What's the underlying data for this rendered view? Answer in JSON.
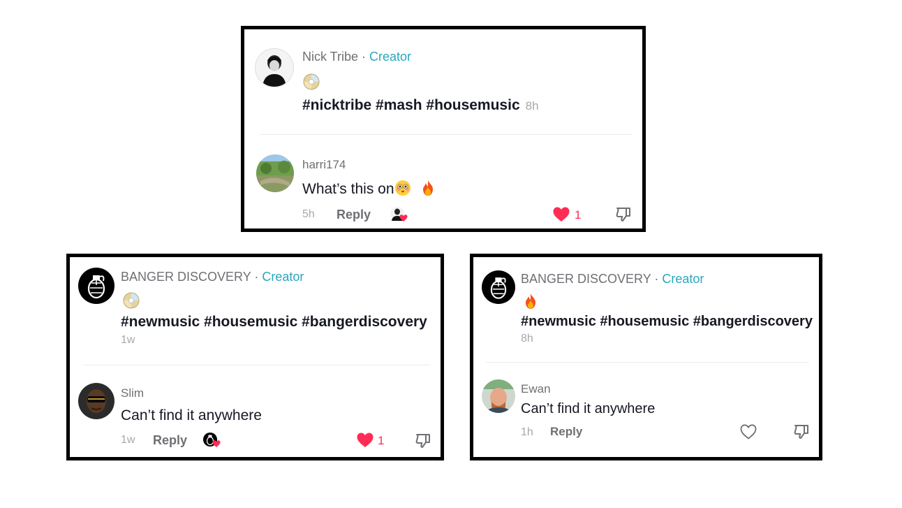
{
  "cards": [
    {
      "author": "Nick Tribe",
      "creator_separator": " · ",
      "creator_label": "Creator",
      "emoji": "cd-emoji",
      "hashtags": "#nicktribe #mash #housemusic",
      "time": "8h",
      "reply": {
        "user": "harri174",
        "text": "What’s this on",
        "emojis": [
          "flushed-face-emoji",
          "fire-emoji"
        ],
        "time": "5h",
        "reply_label": "Reply",
        "liked": true,
        "like_count": "1"
      }
    },
    {
      "author": "BANGER DISCOVERY",
      "creator_separator": " · ",
      "creator_label": "Creator",
      "emoji": "cd-emoji",
      "hashtags": "#newmusic #housemusic #bangerdiscovery",
      "time": "1w",
      "reply": {
        "user": "Slim",
        "text": "Can’t find it anywhere",
        "time": "1w",
        "reply_label": "Reply",
        "liked": true,
        "like_count": "1"
      }
    },
    {
      "author": "BANGER DISCOVERY",
      "creator_separator": " · ",
      "creator_label": "Creator",
      "emoji": "fire-emoji",
      "hashtags": "#newmusic #housemusic #bangerdiscovery",
      "time": "8h",
      "reply": {
        "user": "Ewan",
        "text": "Can’t find it anywhere",
        "time": "1h",
        "reply_label": "Reply",
        "liked": false,
        "like_count": ""
      }
    }
  ],
  "colors": {
    "creator": "#2aa6bd",
    "like": "#fe2c55",
    "muted": "#6f6f74",
    "timestamp": "#a8a8ad",
    "border": "#000000"
  }
}
